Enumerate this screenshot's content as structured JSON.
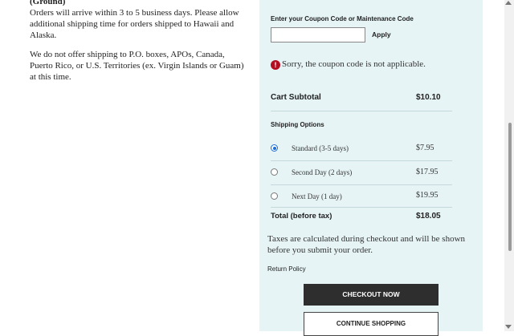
{
  "shipping_info": {
    "heading": "(Ground)",
    "para1": "Orders will arrive within 3 to 5 business days. Please allow additional shipping time for orders shipped to Hawaii and Alaska.",
    "para2": "We do not offer shipping to P.O. boxes, APOs, Canada, Puerto Rico, or U.S. Territories (ex. Virgin Islands or Guam) at this time."
  },
  "coupon": {
    "label": "Enter your Coupon Code or Maintenance Code",
    "value": "",
    "apply_label": "Apply",
    "error_icon": "!",
    "error_message": "Sorry, the coupon code is not applicable."
  },
  "cart": {
    "subtotal_label": "Cart Subtotal",
    "subtotal_value": "$10.10",
    "shipping_title": "Shipping Options",
    "options": [
      {
        "label": "Standard (3-5 days)",
        "price": "$7.95",
        "selected": true
      },
      {
        "label": "Second Day (2 days)",
        "price": "$17.95",
        "selected": false
      },
      {
        "label": "Next Day (1 day)",
        "price": "$19.95",
        "selected": false
      }
    ],
    "total_label": "Total (before tax)",
    "total_value": "$18.05",
    "tax_note": "Taxes are calculated during checkout and will be shown before you submit your order.",
    "return_policy": "Return Policy",
    "checkout_label": "CHECKOUT NOW",
    "continue_label": "CONTINUE SHOPPING"
  },
  "colors": {
    "panel_bg": "#e6f4f6",
    "error_red": "#b40e22",
    "checkout_bg": "#2e2e2e",
    "radio_blue": "#1a6ed8"
  }
}
